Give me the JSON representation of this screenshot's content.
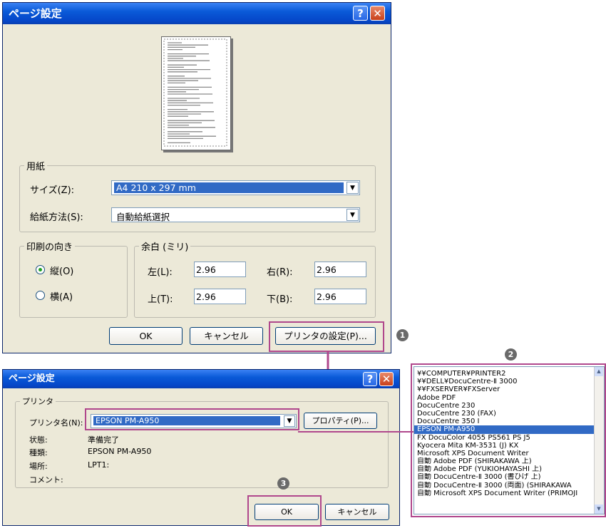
{
  "dialog1": {
    "title": "ページ設定",
    "help": "?",
    "close": "✕",
    "paper_group": "用紙",
    "size_label": "サイズ(Z):",
    "size_value": "A4 210 x 297 mm",
    "source_label": "給紙方法(S):",
    "source_value": "自動給紙選択",
    "orientation_group": "印刷の向き",
    "portrait_label": "縦(O)",
    "landscape_label": "横(A)",
    "margins_group": "余白 (ミリ)",
    "left_label": "左(L):",
    "left_value": "2.96",
    "right_label": "右(R):",
    "right_value": "2.96",
    "top_label": "上(T):",
    "top_value": "2.96",
    "bottom_label": "下(B):",
    "bottom_value": "2.96",
    "ok": "OK",
    "cancel": "キャンセル",
    "printer_setup": "プリンタの設定(P)..."
  },
  "dialog2": {
    "title": "ページ設定",
    "help": "?",
    "close": "✕",
    "printer_group": "プリンタ",
    "name_label": "プリンタ名(N):",
    "name_value": "EPSON PM-A950",
    "properties": "プロパティ(P)...",
    "status_label": "状態:",
    "status_value": "準備完了",
    "type_label": "種類:",
    "type_value": "EPSON PM-A950",
    "where_label": "場所:",
    "where_value": "LPT1:",
    "comment_label": "コメント:",
    "ok": "OK",
    "cancel": "キャンセル"
  },
  "badges": [
    "1",
    "2",
    "3"
  ],
  "printer_list": {
    "items": [
      "¥¥COMPUTER¥PRINTER2",
      "¥¥DELL¥DocuCentre-Ⅱ 3000",
      "¥¥FXSERVER¥FXServer",
      "Adobe PDF",
      "DocuCentre 230",
      "DocuCentre 230 (FAX)",
      "DocuCentre 350 I",
      "EPSON PM-A950",
      "FX DocuColor 4055 PS561 PS J5",
      "Kyocera Mita KM-3531 (J) KX",
      "Microsoft XPS Document Writer",
      "自動 Adobe PDF (SHIRAKAWA 上)",
      "自動 Adobe PDF (YUKIOHAYASHI 上)",
      "自動 DocuCentre-Ⅱ 3000 (書ひげ 上)",
      "自動 DocuCentre-Ⅱ 3000 (両面) (SHIRAKAWA",
      "自動 Microsoft XPS Document Writer (PRIMOJI"
    ],
    "selected_index": 7
  },
  "colors": {
    "highlight": "#b0478c",
    "selection": "#316ac5",
    "titlebar": "#0a5ad8",
    "dialog_bg": "#ece9d8"
  }
}
